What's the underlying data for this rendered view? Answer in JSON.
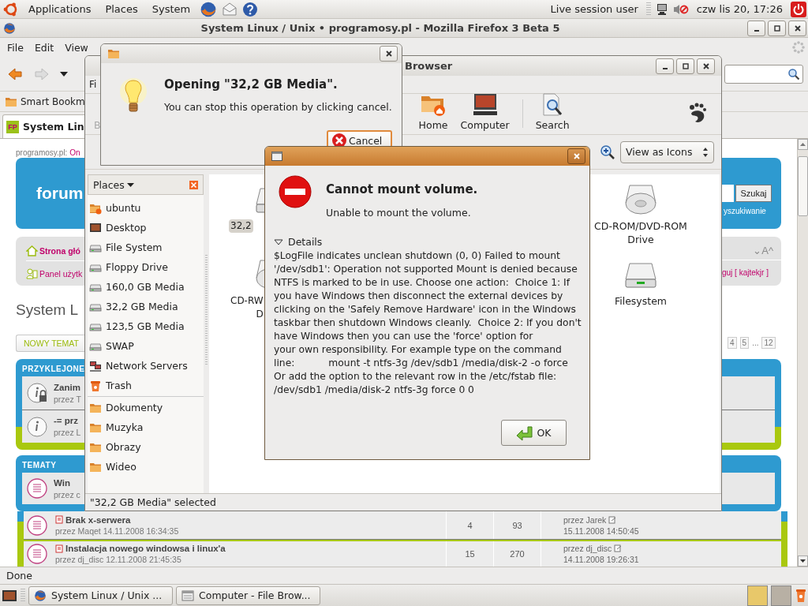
{
  "top_panel": {
    "menus": [
      "Applications",
      "Places",
      "System"
    ],
    "user": "Live session user",
    "clock": "czw lis 20, 17:26"
  },
  "firefox": {
    "title": "System Linux / Unix • programosy.pl - Mozilla Firefox 3 Beta 5",
    "menus": [
      "File",
      "Edit",
      "View"
    ],
    "bookmarks": [
      "Smart Bookm"
    ],
    "tab": {
      "favicon": "FP",
      "label": "System Lin"
    },
    "status": "Done"
  },
  "forum_left": {
    "site": "programosy.pl:",
    "site_link": "On",
    "logo": "forum",
    "nav": [
      {
        "kind": "home",
        "label": "Strona głó"
      },
      {
        "kind": "user",
        "label": "Panel użytk"
      }
    ],
    "heading": "System L",
    "new_topic": "NOWY TEMAT",
    "sticky_header": "PRZYKLEJONE",
    "sticky_rows": [
      {
        "title": "Zanim",
        "meta": "przez T",
        "locked": true
      },
      {
        "title": "-= prz",
        "meta": "przez L",
        "locked": false
      }
    ],
    "topics_header": "TEMATY",
    "topic_rows": [
      {
        "title": "Win",
        "meta": "przez c"
      }
    ]
  },
  "forum_right": {
    "search_button": "Szukaj",
    "search_link": "yszukiwanie",
    "font_controls": "⌄A^",
    "login": "guj [ kajtekjr ]",
    "pages": [
      "4",
      "5",
      "...",
      "12"
    ]
  },
  "topic_rows": [
    {
      "title": "Brak x-serwera",
      "meta": "przez Maqet 14.11.2008 16:34:35",
      "replies": "4",
      "views": "93",
      "last_by": "przez Jarek",
      "last_date": "15.11.2008 14:50:45"
    },
    {
      "title": "Instalacja nowego windowsa i linux'a",
      "meta": "przez dj_disc 12.11.2008 21:45:35",
      "replies": "15",
      "views": "270",
      "last_by": "przez dj_disc",
      "last_date": "14.11.2008 19:26:31"
    }
  ],
  "file_browser": {
    "title": "Browser",
    "menus": [
      "Fi"
    ],
    "toolbar": [
      {
        "kind": "back",
        "label": "B",
        "disabled": true
      },
      {
        "kind": "home",
        "label": "Home",
        "disabled": false
      },
      {
        "kind": "computer",
        "label": "Computer",
        "disabled": false
      },
      {
        "kind": "separator"
      },
      {
        "kind": "search",
        "label": "Search",
        "disabled": false
      }
    ],
    "view_mode": "View as Icons",
    "sidebar_title": "Places",
    "places": [
      {
        "kind": "home",
        "label": "ubuntu"
      },
      {
        "kind": "desktop",
        "label": "Desktop"
      },
      {
        "kind": "drive",
        "label": "File System"
      },
      {
        "kind": "drive",
        "label": "Floppy Drive"
      },
      {
        "kind": "drive",
        "label": "160,0 GB Media"
      },
      {
        "kind": "drive",
        "label": "32,2 GB Media"
      },
      {
        "kind": "drive",
        "label": "123,5 GB Media"
      },
      {
        "kind": "drive",
        "label": "SWAP"
      },
      {
        "kind": "network",
        "label": "Network Servers"
      },
      {
        "kind": "trash",
        "label": "Trash"
      }
    ],
    "bookmarks": [
      {
        "kind": "folder",
        "label": "Dokumenty"
      },
      {
        "kind": "folder",
        "label": "Muzyka"
      },
      {
        "kind": "folder",
        "label": "Obrazy"
      },
      {
        "kind": "folder",
        "label": "Wideo"
      }
    ],
    "icons_left": [
      {
        "kind": "drive",
        "lines": [
          "32,2"
        ],
        "selected": true
      },
      {
        "kind": "cdrom",
        "lines": [
          "CD-RW",
          "D"
        ],
        "selected": false
      }
    ],
    "icons_right": [
      {
        "kind": "cdrom",
        "lines": [
          "CD-ROM/DVD-ROM",
          "Drive"
        ],
        "selected": false
      },
      {
        "kind": "drive",
        "lines": [
          "Filesystem"
        ],
        "selected": false
      }
    ],
    "status": "\"32,2 GB Media\" selected"
  },
  "opening_dialog": {
    "heading": "Opening \"32,2 GB Media\".",
    "message": "You can stop this operation by clicking cancel.",
    "button": "Cancel"
  },
  "error_dialog": {
    "heading": "Cannot mount volume.",
    "message": "Unable to mount the volume.",
    "details_label": "Details",
    "expanded": true,
    "details": "$LogFile indicates unclean shutdown (0, 0) Failed to mount '/dev/sdb1': Operation not supported Mount is denied because NTFS is marked to be in use. Choose one action:  Choice 1: If you have Windows then disconnect the external devices by          clicking on the 'Safely Remove Hardware' icon in the Windows          taskbar then shutdown Windows cleanly.  Choice 2: If you don't have Windows then you can use the 'force' option for          your own responsibility. For example type on the command line:           mount -t ntfs-3g /dev/sdb1 /media/disk-2 -o force      Or add the option to the relevant row in the /etc/fstab file:          /dev/sdb1 /media/disk-2 ntfs-3g force 0 0",
    "button": "OK"
  },
  "taskbar": {
    "tasks": [
      {
        "kind": "browser",
        "label": "System Linux / Unix ..."
      },
      {
        "kind": "file-manager",
        "label": "Computer - File Brow..."
      }
    ],
    "workspaces": [
      {
        "selected": true
      },
      {
        "selected": false
      }
    ]
  }
}
